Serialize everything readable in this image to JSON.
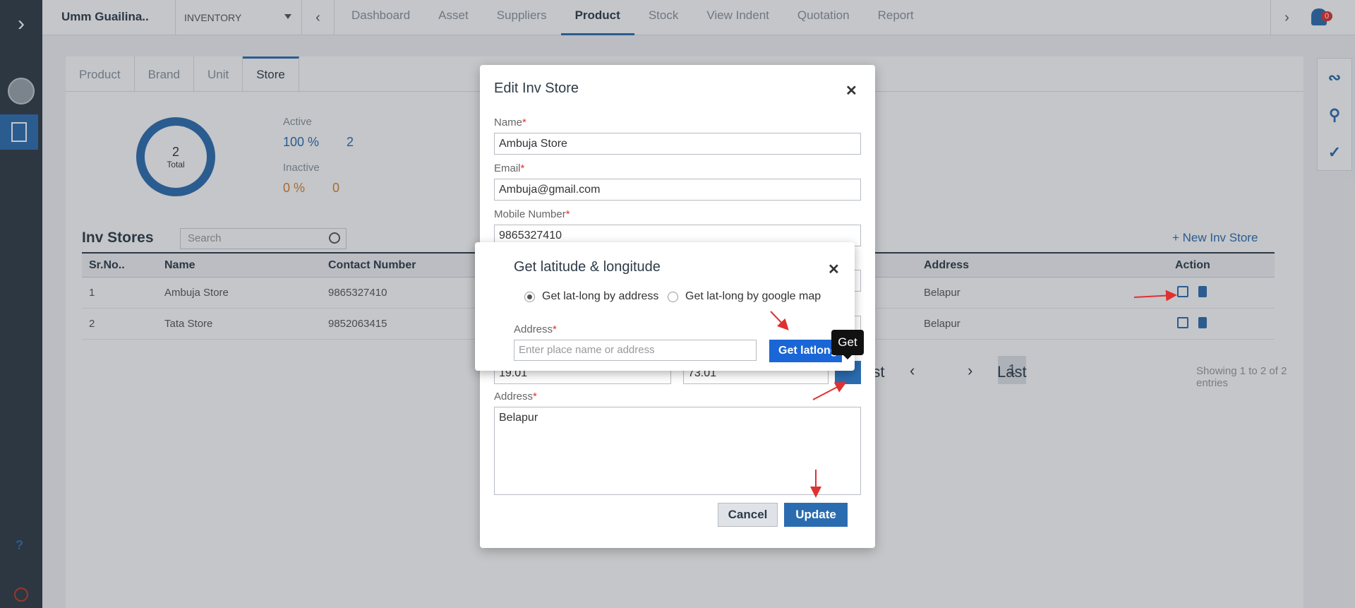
{
  "header": {
    "org": "Umm Guailina..",
    "module": "INVENTORY",
    "tabs": [
      "Dashboard",
      "Asset",
      "Suppliers",
      "Product",
      "Stock",
      "View Indent",
      "Quotation",
      "Report"
    ],
    "active_tab": "Product",
    "notification_count": "0"
  },
  "subtabs": [
    "Product",
    "Brand",
    "Unit",
    "Store"
  ],
  "stats": {
    "total": "2",
    "total_label": "Total",
    "active_label": "Active",
    "active_pct": "100 %",
    "active_count": "2",
    "inactive_label": "Inactive",
    "inactive_pct": "0 %",
    "inactive_count": "0"
  },
  "list": {
    "title": "Inv Stores",
    "search_placeholder": "Search",
    "new_button": "+ New Inv Store",
    "columns": [
      "Sr.No..",
      "Name",
      "Contact Number",
      "Address",
      "Action"
    ],
    "rows": [
      {
        "sr": "1",
        "name": "Ambuja Store",
        "contact": "9865327410",
        "address": "Belapur"
      },
      {
        "sr": "2",
        "name": "Tata Store",
        "contact": "9852063415",
        "address": "Belapur"
      }
    ],
    "pager": {
      "first_partial": "rst",
      "page": "1",
      "last": "Last",
      "showing": "Showing 1 to 2 of 2 entries"
    }
  },
  "edit_modal": {
    "title": "Edit Inv Store",
    "name_label": "Name",
    "name_value": "Ambuja Store",
    "email_label": "Email",
    "email_value": "Ambuja@gmail.com",
    "mobile_label": "Mobile Number",
    "mobile_value": "9865327410",
    "lat_value": "19.01",
    "long_value": "73.01",
    "address_label": "Address",
    "address_value": "Belapur",
    "cancel_label": "Cancel",
    "update_label": "Update"
  },
  "latlong_dialog": {
    "title": "Get latitude & longitude",
    "option_address": "Get lat-long by address",
    "option_map": "Get lat-long by google map",
    "address_label": "Address",
    "address_placeholder": "Enter place name or address",
    "get_button": "Get latlong",
    "tooltip": "Get"
  },
  "colors": {
    "accent": "#2b6cb0",
    "danger": "#e03131",
    "sidebar": "#2f3a45"
  }
}
